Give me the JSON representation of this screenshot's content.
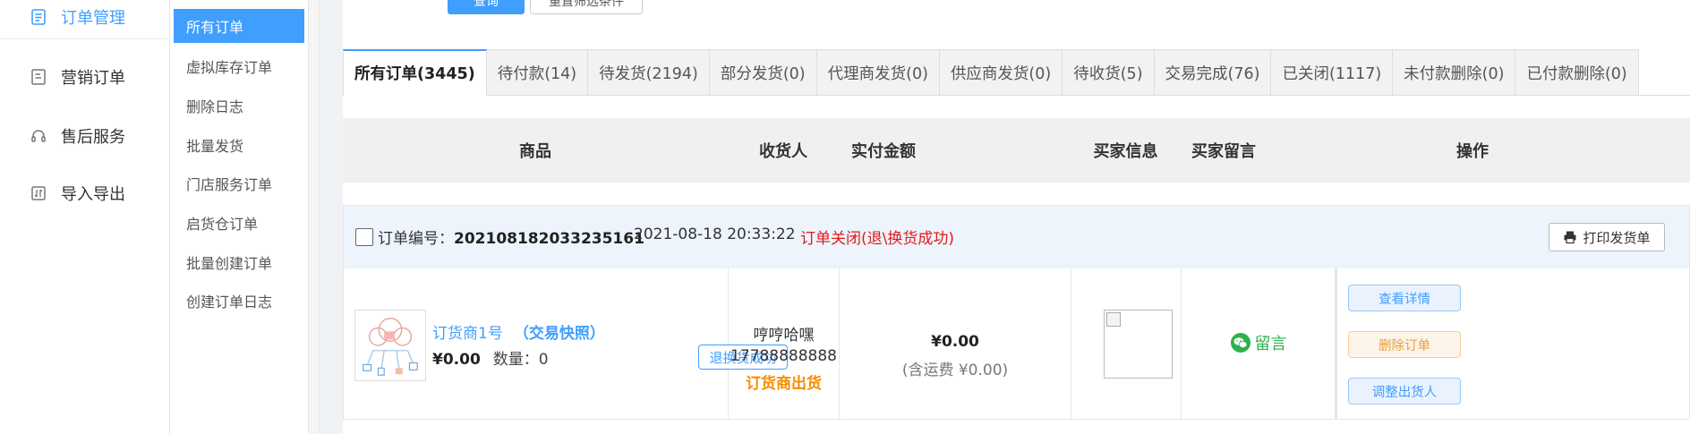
{
  "sidebar": {
    "items": [
      {
        "label": "订单管理",
        "icon": "document-list-icon"
      },
      {
        "label": "营销订单",
        "icon": "note-icon"
      },
      {
        "label": "售后服务",
        "icon": "headset-icon"
      },
      {
        "label": "导入导出",
        "icon": "import-export-icon"
      }
    ]
  },
  "subnav": {
    "items": [
      "所有订单",
      "虚拟库存订单",
      "删除日志",
      "批量发货",
      "门店服务订单",
      "启货仓订单",
      "批量创建订单",
      "创建订单日志"
    ]
  },
  "toolbar": {
    "search_label": "查询",
    "reset_label": "重置筛选条件"
  },
  "tabs": [
    "所有订单(3445)",
    "待付款(14)",
    "待发货(2194)",
    "部分发货(0)",
    "代理商发货(0)",
    "供应商发货(0)",
    "待收货(5)",
    "交易完成(76)",
    "已关闭(1117)",
    "未付款删除(0)",
    "已付款删除(0)"
  ],
  "table_headers": {
    "goods": "商品",
    "consignee": "收货人",
    "amount": "实付金额",
    "buyer": "买家信息",
    "message": "买家留言",
    "actions": "操作"
  },
  "order": {
    "number_label": "订单编号：",
    "number": "202108182033235161",
    "time": "2021-08-18 20:33:22",
    "status": "订单关闭(退\\换货成功)",
    "print_label": "打印发货单",
    "goods": {
      "name": "订货商1号",
      "snapshot": "（交易快照）",
      "price": "¥0.00",
      "qty_label": "数量：0",
      "badge": "退换货成功"
    },
    "consignee": {
      "name": "哼哼哈嘿",
      "phone": "17788888888",
      "ship_by": "订货商出货"
    },
    "amount": {
      "value": "¥0.00",
      "freight": "(含运费 ¥0.00)"
    },
    "message_label": "留言",
    "actions": {
      "view": "查看详情",
      "delete": "删除订单",
      "adjust": "调整出货人"
    }
  },
  "colors": {
    "primary": "#409eff",
    "danger": "#e21a1a",
    "warning": "#f58c00",
    "success": "#2bb24c"
  }
}
